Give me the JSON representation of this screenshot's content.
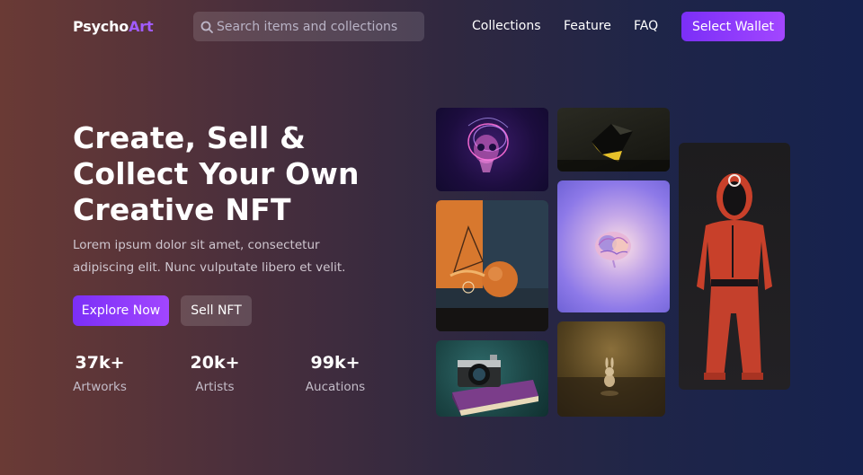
{
  "nav": {
    "logo_main": "Psycho",
    "logo_accent": "Art",
    "search_placeholder": "Search items and collections",
    "links": [
      "Collections",
      "Feature",
      "FAQ"
    ],
    "wallet_label": "Select Wallet"
  },
  "hero": {
    "title": "Create, Sell & Collect Your Own Creative NFT",
    "subtitle": "Lorem ipsum dolor sit amet, consectetur adipiscing elit. Nunc vulputate libero et velit.",
    "primary_button": "Explore Now",
    "secondary_button": "Sell NFT"
  },
  "stats": [
    {
      "value": "37k+",
      "label": "Artworks"
    },
    {
      "value": "20k+",
      "label": "Artists"
    },
    {
      "value": "99k+",
      "label": "Aucations"
    }
  ],
  "gallery": [
    {
      "name": "neon-skull-art"
    },
    {
      "name": "abstract-polyhedron-art"
    },
    {
      "name": "orange-sphere-geometry-art"
    },
    {
      "name": "glowing-brain-art"
    },
    {
      "name": "red-jumpsuit-figure-art"
    },
    {
      "name": "camera-on-book-art"
    },
    {
      "name": "golden-bunny-art"
    }
  ],
  "colors": {
    "accent": "#a15bff",
    "button_gradient_start": "#7b2ff7",
    "button_gradient_end": "#a246ff"
  }
}
